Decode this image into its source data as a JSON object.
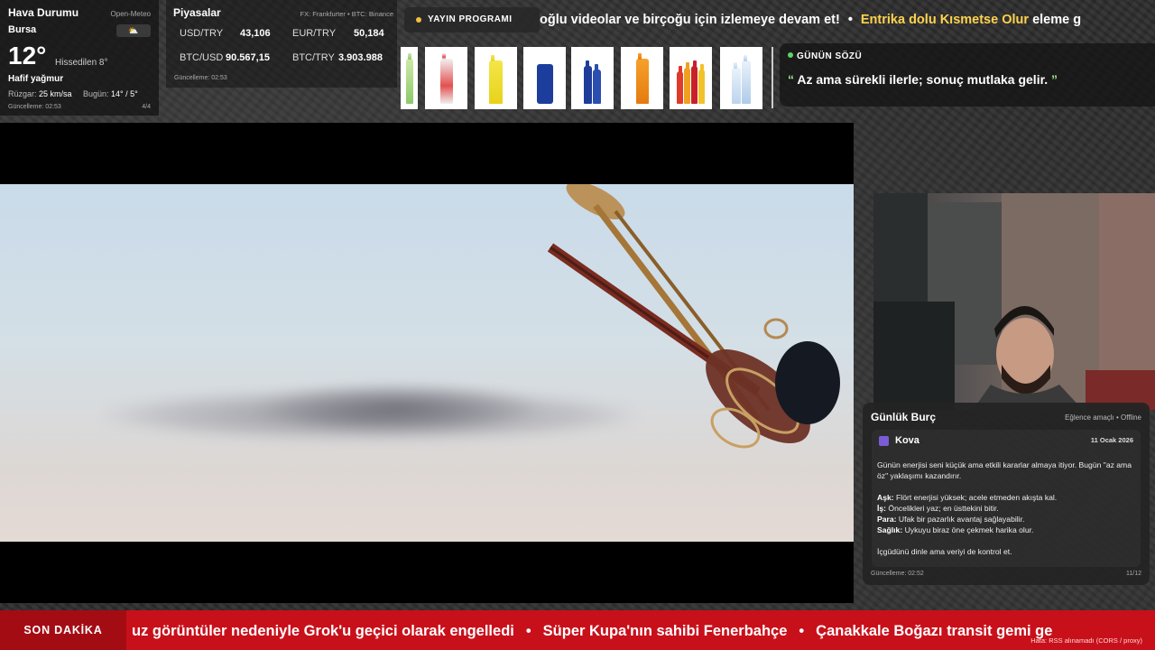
{
  "weather": {
    "title": "Hava Durumu",
    "source": "Open-Meteo",
    "city": "Bursa",
    "icon": "partly-cloudy-icon",
    "temperature": "12°",
    "feels_like": "Hissedilen 8°",
    "condition": "Hafif yağmur",
    "wind_label": "Rüzgar:",
    "wind_value": "25 km/sa",
    "today_label": "Bugün:",
    "today_value": "14° / 5°",
    "updated": "Güncelleme: 02:53",
    "page": "4/4"
  },
  "markets": {
    "title": "Piyasalar",
    "source": "FX: Frankfurter • BTC: Binance",
    "rows": [
      {
        "label": "USD/TRY",
        "value": "43,106"
      },
      {
        "label": "EUR/TRY",
        "value": "50,184"
      },
      {
        "label": "BTC/USD",
        "value": "90.567,15"
      },
      {
        "label": "BTC/TRY",
        "value": "3.903.988"
      }
    ],
    "updated": "Güncelleme: 02:53"
  },
  "schedule": {
    "label": "YAYIN PROGRAMI"
  },
  "top_ticker": {
    "part1": "oğlu videolar ve birçoğu için izlemeye devam et!",
    "separator": "•",
    "part2_highlight": "Entrika dolu Kısmetse Olur",
    "part2_rest": "eleme g"
  },
  "quote": {
    "heading": "GÜNÜN SÖZÜ",
    "open_mark": "“",
    "text": "Az ama sürekli ilerle; sonuç mutlaka gelir.",
    "close_mark": "”"
  },
  "horoscope": {
    "title": "Günlük Burç",
    "meta": "Eğlence amaçlı • Offline",
    "sign": "Kova",
    "date": "11 Ocak 2026",
    "intro": "Günün enerjisi seni küçük ama etkili kararlar almaya itiyor. Bugün \"az ama öz\" yaklaşımı kazandırır.",
    "love_label": "Aşk:",
    "love": "Flört enerjisi yüksek; acele etmeden akışta kal.",
    "work_label": "İş:",
    "work": "Öncelikleri yaz; en üsttekini bitir.",
    "money_label": "Para:",
    "money": "Ufak bir pazarlık avantaj sağlayabilir.",
    "health_label": "Sağlık:",
    "health": "Uykuyu biraz öne çekmek harika olur.",
    "advice": "İçgüdünü dinle ama veriyi de kontrol et.",
    "updated": "Güncelleme: 02:52",
    "page": "11/12"
  },
  "breaking": {
    "label": "SON DAKİKA",
    "items": [
      "uz görüntüler nedeniyle Grok'u geçici olarak engelledi",
      "Süper Kupa'nın sahibi Fenerbahçe",
      "Çanakkale Boğazı transit gemi ge"
    ],
    "separator": "•",
    "error": "Hata: RSS alınamadı (CORS / proxy)"
  },
  "colors": {
    "highlight": "#ffd34d",
    "quote_mark": "#9ee28e",
    "breaking_bg": "#c8101b",
    "breaking_label_bg": "#a40c14",
    "status_dot": "#5ed36a",
    "schedule_dot": "#f0c040"
  }
}
